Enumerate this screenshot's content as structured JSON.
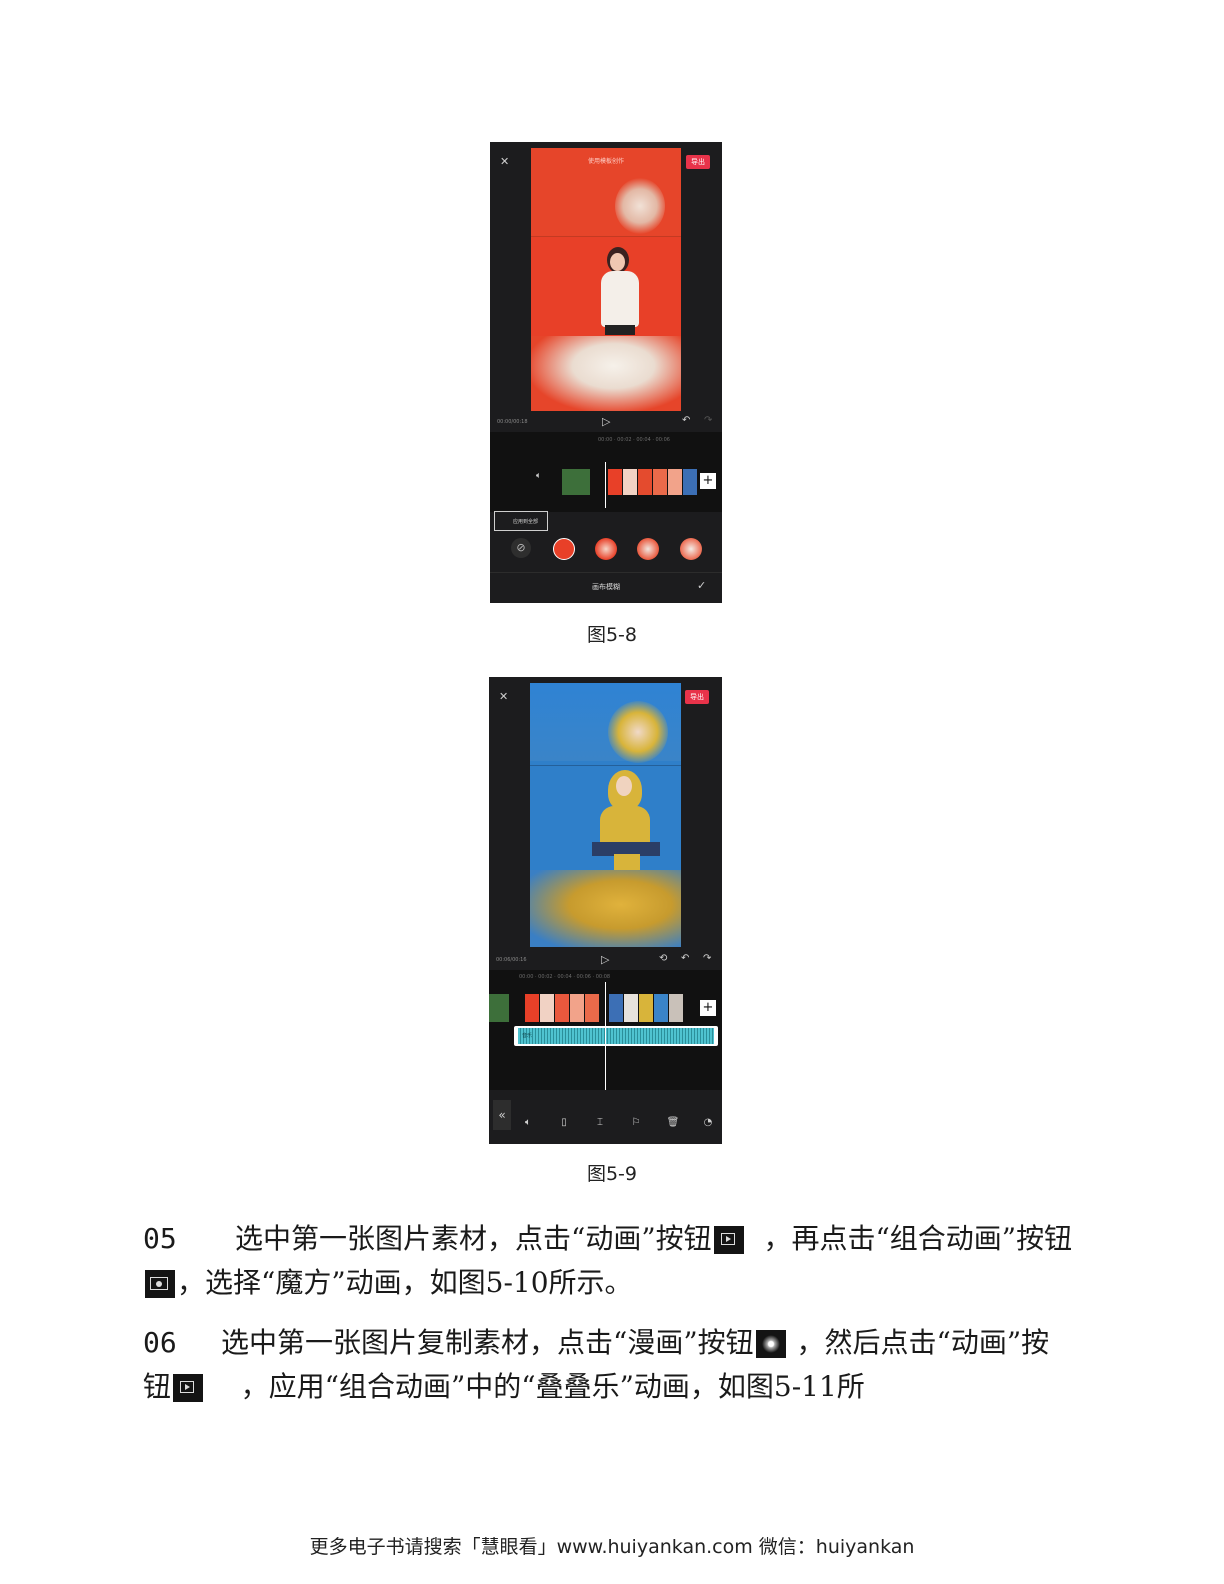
{
  "figures": [
    {
      "caption": "图5-8",
      "screen": {
        "export_label": "导出",
        "top_text": "使用模板创作",
        "timecode": "00:00/00:18",
        "panel_option_label": "应用到全部",
        "panel_title": "画布模糊"
      }
    },
    {
      "caption": "图5-9",
      "screen": {
        "export_label": "导出",
        "timecode": "00:06/00:16",
        "audio_label": "音乐"
      }
    }
  ],
  "steps": [
    {
      "number": "05",
      "text_1": "选中第一张图片素材，点击“动画”按钮",
      "text_2": "，再点击“组合动画”按钮",
      "text_3": "，选择“魔方”动画，如图5-10所示。"
    },
    {
      "number": "06",
      "text_1": "选中第一张图片复制素材，点击“漫画”按钮",
      "text_2": "，然后点击“动画”按钮",
      "text_3": "，应用“组合动画”中的“叠叠乐”动画，如图5-11所"
    }
  ],
  "footer": "更多电子书请搜索「慧眼看」www.huiyankan.com   微信：huiyankan",
  "colors": {
    "accent": "#e8334a",
    "fig1_bg": "#e6452a",
    "fig2_bg": "#2f7fc9",
    "fig2_yellow": "#d8b43a",
    "audio_wave": "#4fc3d0"
  },
  "icons": [
    "close-icon",
    "fullscreen-icon",
    "play-icon",
    "undo-icon",
    "redo-icon",
    "volume-icon",
    "plus-icon",
    "confirm-icon",
    "no-blur-icon",
    "back-icon",
    "animation-button-icon",
    "combo-animation-button-icon",
    "comic-button-icon"
  ]
}
